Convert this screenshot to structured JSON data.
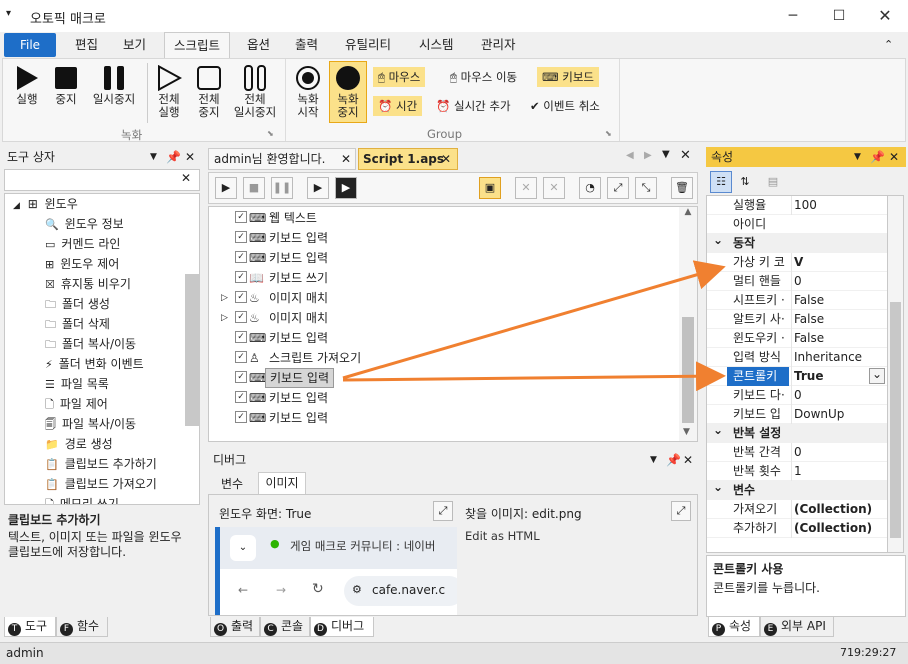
{
  "window": {
    "title": "오토픽 매크로",
    "qat_icon": "dropdown-icon"
  },
  "menu": {
    "file": "File",
    "items": [
      "편집",
      "보기",
      "스크립트",
      "옵션",
      "출력",
      "유틸리티",
      "시스템",
      "관리자"
    ],
    "active": "스크립트"
  },
  "ribbon": {
    "rec_buttons": [
      "실행",
      "중지",
      "일시중지"
    ],
    "all_buttons": [
      [
        "전체",
        "실행"
      ],
      [
        "전체",
        "중지"
      ],
      [
        "전체",
        "일시중지"
      ]
    ],
    "rec_group_label": "녹화",
    "record_start": [
      "녹화",
      "시작"
    ],
    "record_stop": [
      "녹화",
      "중지"
    ],
    "mouse": "마우스",
    "mouse_move": "마우스 이동",
    "keyboard": "키보드",
    "time": "시간",
    "realtime_add": "실시간 추가",
    "event_cancel": "이벤트 취소",
    "group_label": "Group"
  },
  "toolbox": {
    "title": "도구 상자",
    "search_placeholder": "",
    "root": "윈도우",
    "items": [
      "윈도우 정보",
      "커멘드 라인",
      "윈도우 제어",
      "휴지통 비우기",
      "폴더 생성",
      "폴더 삭제",
      "폴더 복사/이동",
      "폴더 변화 이벤트",
      "파일 목록",
      "파일 제어",
      "파일 복사/이동",
      "경로 생성",
      "클립보드 추가하기",
      "클립보드 가져오기",
      "메모리 쓰기"
    ],
    "desc_title": "클립보드 추가하기",
    "desc_text": "텍스트, 이미지 또는 파일을 윈도우 클립보드에 저장합니다.",
    "tabs": [
      "도구",
      "함수"
    ]
  },
  "editor": {
    "tabs": [
      "admin님 환영합니다.",
      "Script 1.aps"
    ],
    "active_tab": "Script 1.aps",
    "lines": [
      {
        "text": "웹 텍스트",
        "icon": "keyboard-icon",
        "expand": false
      },
      {
        "text": "키보드 입력",
        "icon": "keyboard-icon",
        "expand": false
      },
      {
        "text": "키보드 입력",
        "icon": "keyboard-icon",
        "expand": false
      },
      {
        "text": "키보드 쓰기",
        "icon": "book-icon",
        "expand": false
      },
      {
        "text": "이미지 매치",
        "icon": "image-match-icon",
        "expand": true
      },
      {
        "text": "이미지 매치",
        "icon": "image-match-icon",
        "expand": true
      },
      {
        "text": "키보드 입력",
        "icon": "keyboard-icon",
        "expand": false
      },
      {
        "text": "스크립트 가져오기",
        "icon": "script-import-icon",
        "expand": false
      },
      {
        "text": "키보드 입력",
        "icon": "keyboard-icon",
        "expand": false,
        "selected": true
      },
      {
        "text": "키보드 입력",
        "icon": "keyboard-icon",
        "expand": false
      },
      {
        "text": "키보드 입력",
        "icon": "keyboard-icon",
        "expand": false
      }
    ]
  },
  "debug": {
    "title": "디버그",
    "tabs": [
      "변수",
      "이미지"
    ],
    "active_tab": "이미지",
    "window_screen": "윈도우 화면: True",
    "find_image": "찾을 이미지: edit.png",
    "edit_as_html": "Edit as HTML",
    "browser_tab": "게임 매크로 커뮤니티 : 네이버",
    "browser_url": "cafe.naver.c",
    "bottom_tabs": [
      "출력",
      "콘솔",
      "디버그"
    ],
    "active_bottom": "디버그"
  },
  "props": {
    "title": "속성",
    "rows": [
      {
        "name": "실행율",
        "value": "100",
        "cat": false
      },
      {
        "name": "아이디",
        "value": "",
        "cat": false
      },
      {
        "name": "동작",
        "value": "",
        "cat": true
      },
      {
        "name": "가상 키 코",
        "value": "V",
        "cat": false,
        "bold": true
      },
      {
        "name": "멀티 핸들",
        "value": "0",
        "cat": false
      },
      {
        "name": "시프트키 ·",
        "value": "False",
        "cat": false
      },
      {
        "name": "알트키 사·",
        "value": "False",
        "cat": false
      },
      {
        "name": "윈도우키 ·",
        "value": "False",
        "cat": false
      },
      {
        "name": "입력 방식",
        "value": "Inheritance",
        "cat": false
      },
      {
        "name": "콘트롤키",
        "value": "True",
        "cat": false,
        "bold": true,
        "selected": true
      },
      {
        "name": "키보드 다·",
        "value": "0",
        "cat": false
      },
      {
        "name": "키보드 입",
        "value": "DownUp",
        "cat": false
      },
      {
        "name": "반복 설정",
        "value": "",
        "cat": true
      },
      {
        "name": "반복 간격",
        "value": "0",
        "cat": false
      },
      {
        "name": "반복 횟수",
        "value": "1",
        "cat": false
      },
      {
        "name": "변수",
        "value": "",
        "cat": true
      },
      {
        "name": "가져오기",
        "value": "(Collection)",
        "cat": false,
        "bold": true
      },
      {
        "name": "추가하기",
        "value": "(Collection)",
        "cat": false,
        "bold": true
      }
    ],
    "desc_title": "콘트롤키 사용",
    "desc_text": "콘트롤키를 누릅니다.",
    "tabs": [
      "속성",
      "외부 API"
    ]
  },
  "status": {
    "user": "admin",
    "time": "719:29:27"
  },
  "colors": {
    "accent": "#1e6ec8",
    "highlight": "#fbe18a",
    "arrow": "#f08030",
    "panel_head_active": "#f5c842"
  }
}
